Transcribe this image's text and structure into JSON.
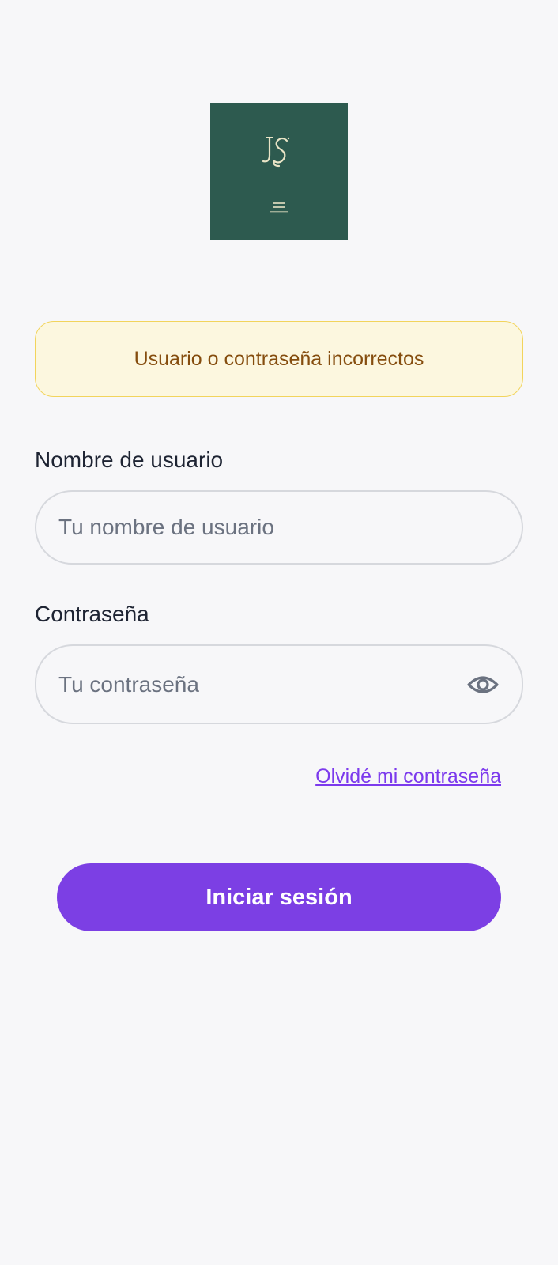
{
  "logo": {
    "monogram": "JS",
    "subtext": "JOVEN JOVEN",
    "background_color": "#2d5a4f",
    "accent_color": "#e9e4c6"
  },
  "alert": {
    "message": "Usuario o contraseña incorrectos",
    "background_color": "#fcf7df",
    "border_color": "#f2d45c",
    "text_color": "#854d0e"
  },
  "username": {
    "label": "Nombre de usuario",
    "placeholder": "Tu nombre de usuario",
    "value": ""
  },
  "password": {
    "label": "Contraseña",
    "placeholder": "Tu contraseña",
    "value": "",
    "toggle_icon": "eye-icon"
  },
  "forgot_link": "Olvidé mi contraseña",
  "login_button": "Iniciar sesión",
  "colors": {
    "accent": "#7c3fe4",
    "background": "#f7f7f9"
  }
}
